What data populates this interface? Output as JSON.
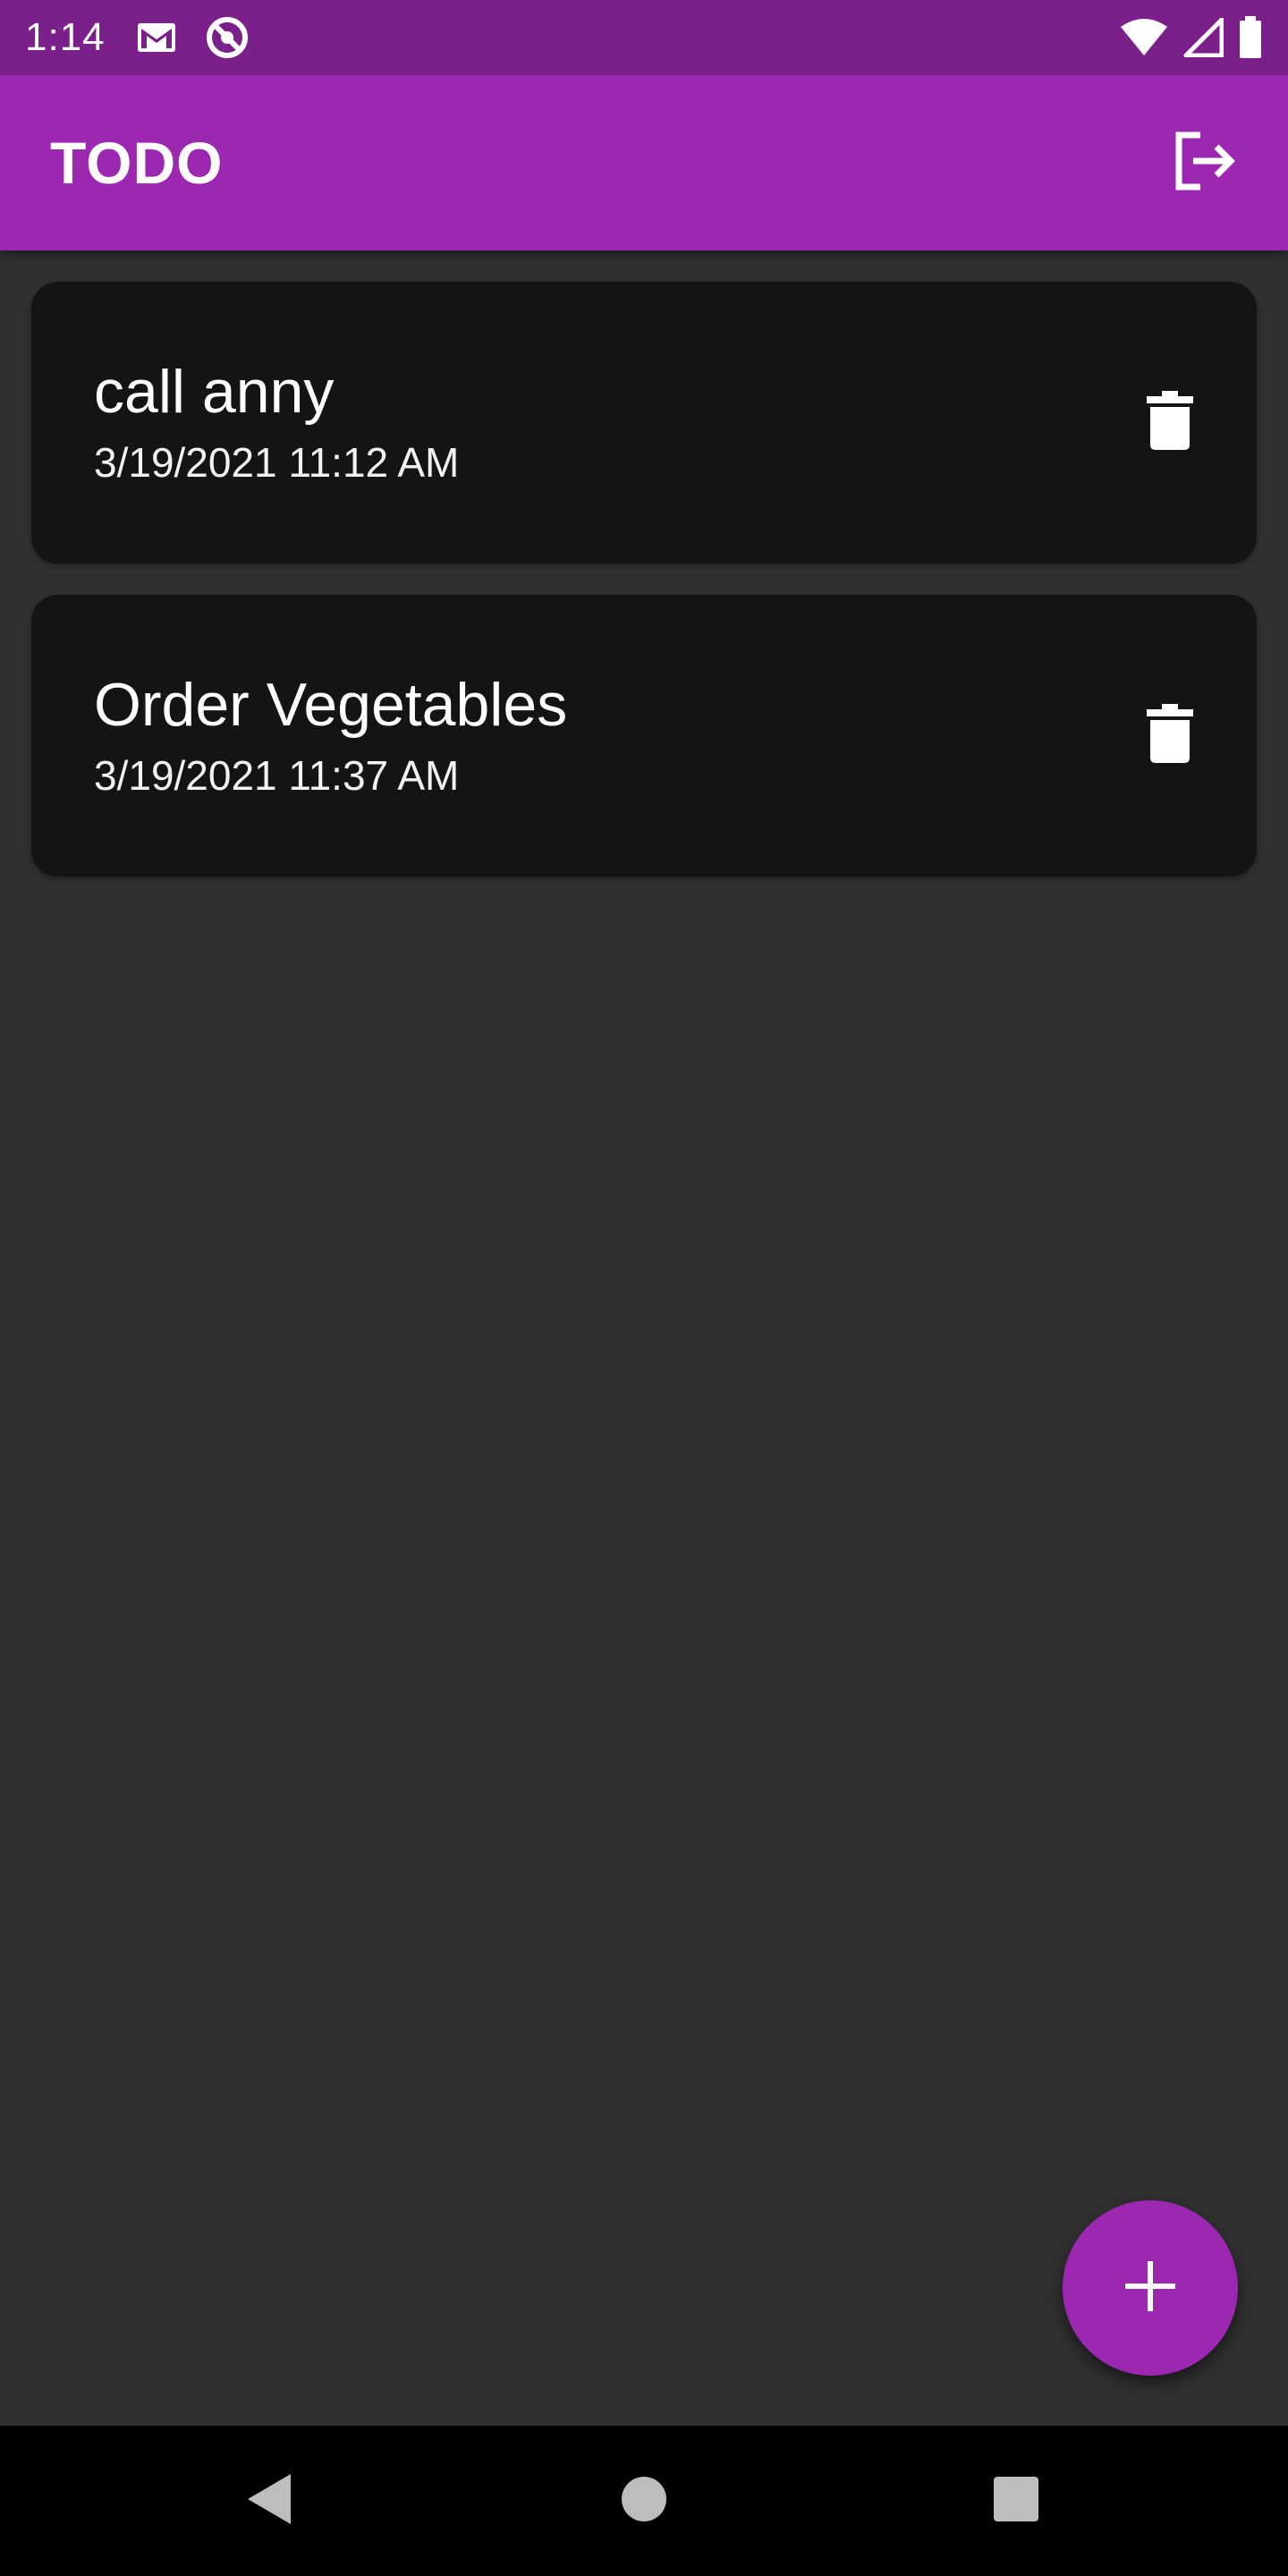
{
  "status_bar": {
    "time": "1:14",
    "left_icons": [
      "gmail-icon",
      "assistant-icon"
    ],
    "right_icons": [
      "wifi-icon",
      "signal-icon",
      "battery-icon"
    ]
  },
  "app_bar": {
    "title": "TODO",
    "action_icon": "logout-icon"
  },
  "todos": [
    {
      "title": "call anny",
      "date": "3/19/2021 11:12 AM",
      "action_icon": "delete-icon"
    },
    {
      "title": "Order Vegetables",
      "date": "3/19/2021 11:37 AM",
      "action_icon": "delete-icon"
    }
  ],
  "fab": {
    "icon": "add-icon"
  },
  "nav_bar": {
    "buttons": [
      "back-icon",
      "home-icon",
      "recents-icon"
    ]
  },
  "colors": {
    "primary": "#9c27b0",
    "primary_dark": "#7b1f8a",
    "background": "#303030",
    "card": "#141414"
  }
}
